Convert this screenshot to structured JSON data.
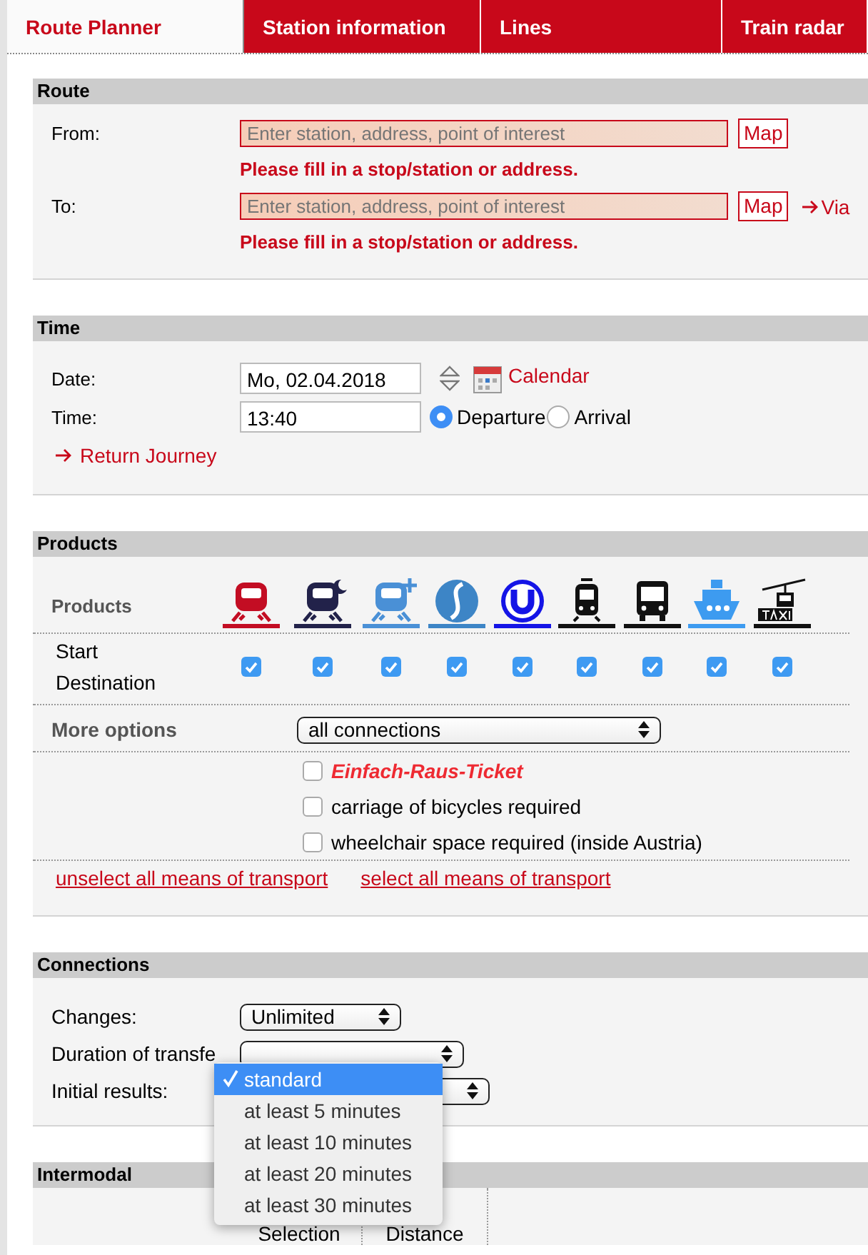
{
  "tabs": [
    {
      "label": "Route Planner",
      "selected": true
    },
    {
      "label": "Station information",
      "selected": false
    },
    {
      "label": "Lines",
      "selected": false
    },
    {
      "label": "Train radar",
      "selected": false
    }
  ],
  "route": {
    "title": "Route",
    "fields": [
      {
        "label": "From:",
        "placeholder": "Enter station, address, point of interest",
        "map_button": "Map",
        "error": "Please fill in a stop/station or address."
      },
      {
        "label": "To:",
        "placeholder": "Enter station, address, point of interest",
        "map_button": "Map",
        "via_link": "Via",
        "error": "Please fill in a stop/station or address."
      }
    ]
  },
  "time": {
    "title": "Time",
    "date": {
      "label": "Date:",
      "value": "Mo, 02.04.2018"
    },
    "calendar_link": "Calendar",
    "time": {
      "label": "Time:",
      "value": "13:40"
    },
    "modes": [
      {
        "label": "Departure",
        "selected": true
      },
      {
        "label": "Arrival",
        "selected": false
      }
    ],
    "return_link": "Return Journey"
  },
  "products": {
    "title": "Products",
    "label": "Products",
    "row_labels": [
      "Start",
      "Destination"
    ],
    "items": [
      {
        "kind": "train",
        "color": "#c30d23",
        "checked": true
      },
      {
        "kind": "night-train",
        "color": "#22224a",
        "checked": true
      },
      {
        "kind": "plus-train",
        "color": "#4a90d6",
        "checked": true
      },
      {
        "kind": "s-bahn",
        "color": "#3d85c6",
        "checked": true
      },
      {
        "kind": "u-bahn",
        "color": "#1414e6",
        "checked": true
      },
      {
        "kind": "tram",
        "color": "#111111",
        "checked": true
      },
      {
        "kind": "bus",
        "color": "#111111",
        "checked": true
      },
      {
        "kind": "ship",
        "color": "#3d9bf0",
        "checked": true
      },
      {
        "kind": "cable-taxi",
        "color": "#111111",
        "checked": true
      }
    ],
    "more_options": {
      "label": "More options",
      "value": "all connections"
    },
    "options": [
      {
        "kind": "promo",
        "label": "Einfach-Raus-Ticket",
        "checked": false
      },
      {
        "kind": "plain",
        "label": "carriage of bicycles required",
        "checked": false
      },
      {
        "kind": "plain",
        "label": "wheelchair space required (inside Austria)",
        "checked": false
      }
    ],
    "links": [
      "unselect all means of transport",
      "select all means of transport"
    ]
  },
  "connections": {
    "title": "Connections",
    "rows": [
      {
        "label": "Changes:",
        "value": "Unlimited"
      },
      {
        "label": "Duration of transfe"
      },
      {
        "label": "Initial results:"
      }
    ],
    "dropdown": {
      "options": [
        {
          "label": "standard",
          "selected": true
        },
        {
          "label": "at least 5 minutes",
          "selected": false
        },
        {
          "label": "at least 10 minutes",
          "selected": false
        },
        {
          "label": "at least 20 minutes",
          "selected": false
        },
        {
          "label": "at least 30 minutes",
          "selected": false
        }
      ]
    }
  },
  "intermodal": {
    "title": "Intermodal",
    "columns": [
      "Selection",
      "Distance"
    ]
  }
}
